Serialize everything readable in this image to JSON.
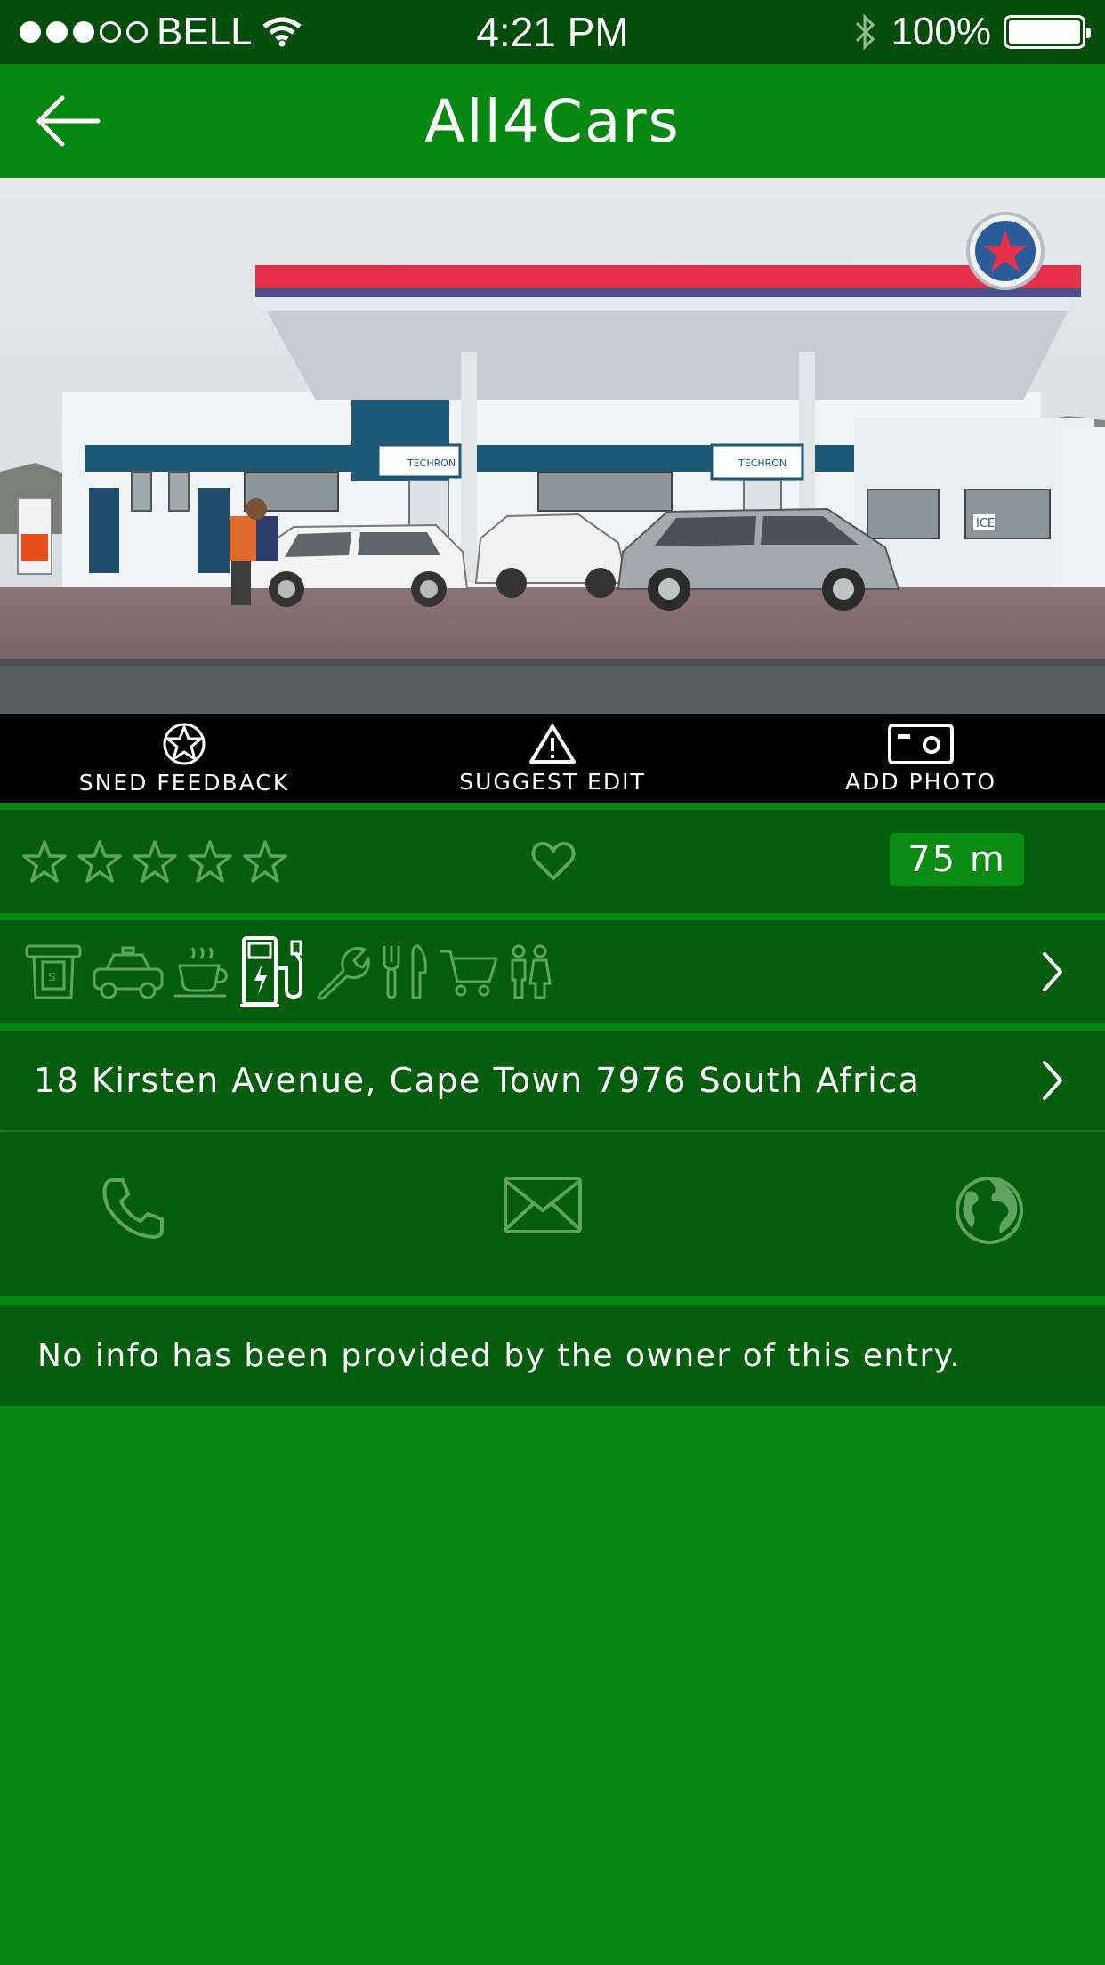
{
  "status_bar": {
    "carrier": "BELL",
    "time": "4:21 PM",
    "battery": "100%",
    "signal_bars": 3,
    "signal_total": 5
  },
  "nav": {
    "title": "All4Cars",
    "back_icon": "arrow-left-icon"
  },
  "photo": {
    "station_sign": "TECHRON",
    "shop_sign": "ICE"
  },
  "actions": [
    {
      "label": "SNED FEEDBACK",
      "icon": "star-badge-icon"
    },
    {
      "label": "SUGGEST EDIT",
      "icon": "warning-triangle-icon"
    },
    {
      "label": "ADD PHOTO",
      "icon": "camera-icon"
    }
  ],
  "rating": {
    "stars_filled": 0,
    "stars_total": 5,
    "favorite_icon": "heart-icon",
    "distance": "75 m"
  },
  "amenities": [
    {
      "name": "atm-icon",
      "active": false
    },
    {
      "name": "taxi-icon",
      "active": false
    },
    {
      "name": "coffee-icon",
      "active": false
    },
    {
      "name": "ev-charging-icon",
      "active": true
    },
    {
      "name": "wrench-icon",
      "active": false
    },
    {
      "name": "restaurant-icon",
      "active": false
    },
    {
      "name": "cart-icon",
      "active": false
    },
    {
      "name": "restroom-icon",
      "active": false
    }
  ],
  "address": "18 Kirsten Avenue, Cape Town 7976 South Africa",
  "contacts": [
    "phone-icon",
    "email-icon",
    "globe-icon"
  ],
  "info": "No info has been provided by the owner of this entry.",
  "colors": {
    "primary_green": "#048812",
    "dark_green": "#045d0d",
    "status_green": "#034d0a",
    "inactive_icon": "#5fa463",
    "black_bar": "#000000"
  }
}
